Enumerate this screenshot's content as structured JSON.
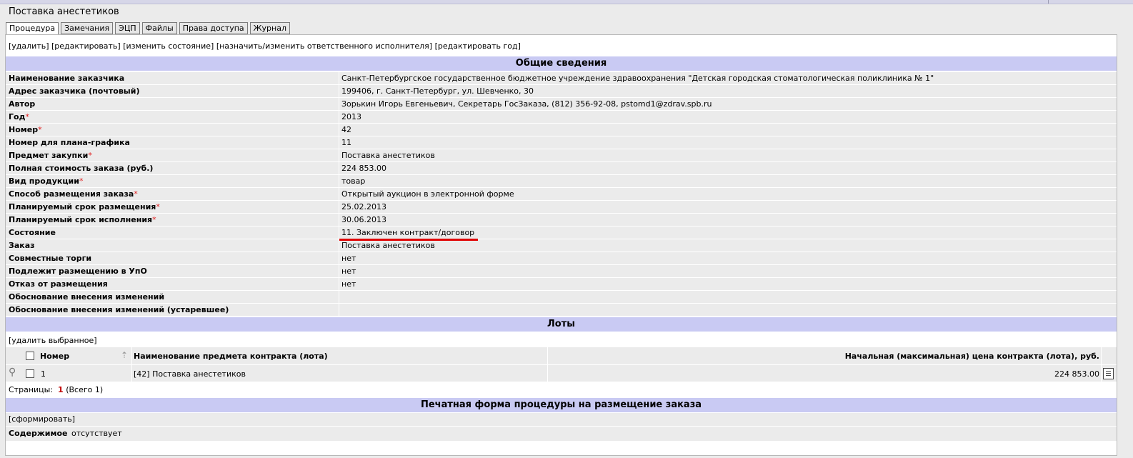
{
  "page_title": "Поставка анестетиков",
  "tabs": [
    {
      "label": "Процедура",
      "active": true
    },
    {
      "label": "Замечания",
      "active": false
    },
    {
      "label": "ЭЦП",
      "active": false
    },
    {
      "label": "Файлы",
      "active": false
    },
    {
      "label": "Права доступа",
      "active": false
    },
    {
      "label": "Журнал",
      "active": false
    }
  ],
  "actions": {
    "delete": "[удалить]",
    "edit": "[редактировать]",
    "change_state": "[изменить состояние]",
    "assign_executor": "[назначить/изменить ответственного исполнителя]",
    "edit_year": "[редактировать год]"
  },
  "general": {
    "title": "Общие сведения",
    "rows": [
      {
        "label": "Наименование заказчика",
        "required": false,
        "value": "Санкт-Петербургское государственное бюджетное учреждение здравоохранения \"Детская городская стоматологическая поликлиника № 1\""
      },
      {
        "label": "Адрес заказчика (почтовый)",
        "required": false,
        "value": "199406, г. Санкт-Петербург, ул. Шевченко, 30"
      },
      {
        "label": "Автор",
        "required": false,
        "value": "Зорькин Игорь Евгеньевич, Секретарь ГосЗаказа, (812) 356-92-08, pstomd1@zdrav.spb.ru"
      },
      {
        "label": "Год",
        "required": true,
        "value": "2013"
      },
      {
        "label": "Номер",
        "required": true,
        "value": "42"
      },
      {
        "label": "Номер для плана-графика",
        "required": false,
        "value": "11"
      },
      {
        "label": "Предмет закупки",
        "required": true,
        "value": "Поставка анестетиков"
      },
      {
        "label": "Полная стоимость заказа (руб.)",
        "required": false,
        "value": "224 853.00"
      },
      {
        "label": "Вид продукции",
        "required": true,
        "value": "товар"
      },
      {
        "label": "Способ размещения заказа",
        "required": true,
        "value": "Открытый аукцион в электронной форме"
      },
      {
        "label": "Планируемый срок размещения",
        "required": true,
        "value": "25.02.2013"
      },
      {
        "label": "Планируемый срок исполнения",
        "required": true,
        "value": "30.06.2013"
      },
      {
        "label": "Состояние",
        "required": false,
        "value": "11. Заключен контракт/договор"
      },
      {
        "label": "Заказ",
        "required": false,
        "value": "Поставка анестетиков"
      },
      {
        "label": "Совместные торги",
        "required": false,
        "value": "нет"
      },
      {
        "label": "Подлежит размещению в УпО",
        "required": false,
        "value": "нет"
      },
      {
        "label": "Отказ от размещения",
        "required": false,
        "value": "нет"
      },
      {
        "label": "Обоснование внесения изменений",
        "required": false,
        "value": ""
      },
      {
        "label": "Обоснование внесения изменений (устаревшее)",
        "required": false,
        "value": ""
      }
    ],
    "required_mark": "*"
  },
  "lots": {
    "title": "Лоты",
    "delete_selected": "[удалить выбранное]",
    "columns": {
      "number": "Номер",
      "name": "Наименование предмета контракта (лота)",
      "price": "Начальная (максимальная) цена контракта (лота), руб."
    },
    "rows": [
      {
        "number": "1",
        "name": "[42] Поставка анестетиков",
        "price": "224 853.00"
      }
    ],
    "pages_label": "Страницы:",
    "current_page": "1",
    "total": "(Всего 1)"
  },
  "print_form": {
    "title": "Печатная форма процедуры на размещение заказа",
    "generate": "[сформировать]",
    "content_label": "Содержимое",
    "content_value": "отсутствует"
  },
  "colors": {
    "section_header": "#c9caf3",
    "row_bg": "#ebebeb",
    "required": "#e02020",
    "highlight_underline": "#e00000",
    "current_page": "#c00000"
  }
}
